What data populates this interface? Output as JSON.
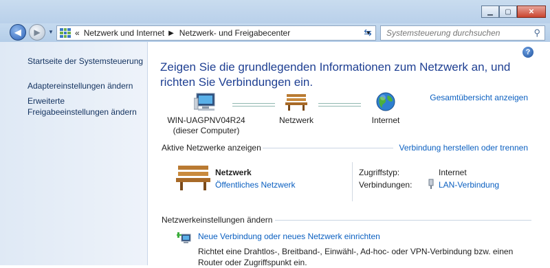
{
  "window": {
    "min_icon": "minimize-icon",
    "max_icon": "maximize-icon",
    "close_icon": "close-icon"
  },
  "address": {
    "overflow": "«",
    "crumbs": [
      "Netzwerk und Internet",
      "Netzwerk- und Freigabecenter"
    ],
    "search_placeholder": "Systemsteuerung durchsuchen"
  },
  "sidebar": {
    "items": [
      {
        "label": "Startseite der Systemsteuerung"
      },
      {
        "label": "Adaptereinstellungen ändern"
      },
      {
        "label": "Erweiterte\nFreigabeeinstellungen ändern"
      }
    ]
  },
  "main": {
    "heading": "Zeigen Sie die grundlegenden Informationen zum Netzwerk an, und richten Sie Verbindungen ein.",
    "overview_link": "Gesamtübersicht anzeigen",
    "map": {
      "computer": "WIN-UAGPNV04R24\n(dieser Computer)",
      "network": "Netzwerk",
      "internet": "Internet"
    },
    "active": {
      "title": "Aktive Netzwerke anzeigen",
      "connect_link": "Verbindung herstellen oder trennen",
      "network_name": "Netzwerk",
      "network_type": "Öffentliches Netzwerk",
      "access_label": "Zugriffstyp:",
      "access_value": "Internet",
      "connections_label": "Verbindungen:",
      "connections_value": "LAN-Verbindung"
    },
    "settings": {
      "title": "Netzwerkeinstellungen ändern",
      "new_conn_link": "Neue Verbindung oder neues Netzwerk einrichten",
      "new_conn_desc": "Richtet eine Drahtlos-, Breitband-, Einwähl-, Ad-hoc- oder VPN-Verbindung bzw. einen Router oder Zugriffspunkt ein."
    }
  }
}
